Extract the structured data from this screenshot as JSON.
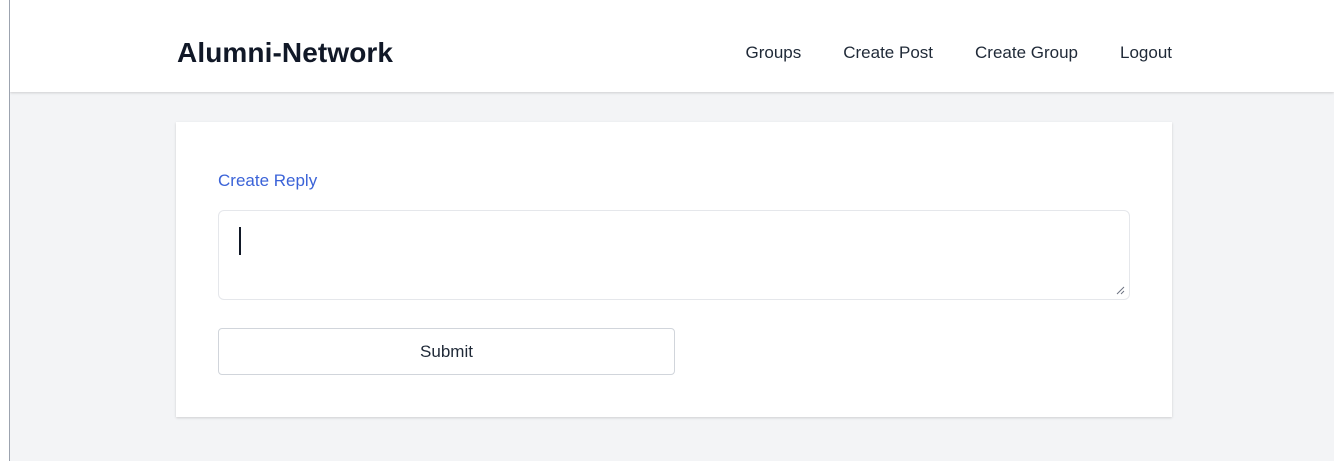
{
  "brand": {
    "name": "Alumni-Network"
  },
  "nav": {
    "links": [
      {
        "label": "Groups"
      },
      {
        "label": "Create Post"
      },
      {
        "label": "Create Group"
      },
      {
        "label": "Logout"
      }
    ]
  },
  "reply_form": {
    "title": "Create Reply",
    "textarea_value": "",
    "submit_label": "Submit"
  },
  "colors": {
    "background": "#f3f4f6",
    "card": "#ffffff",
    "link_blue": "#3b63d8",
    "text": "#111827"
  }
}
